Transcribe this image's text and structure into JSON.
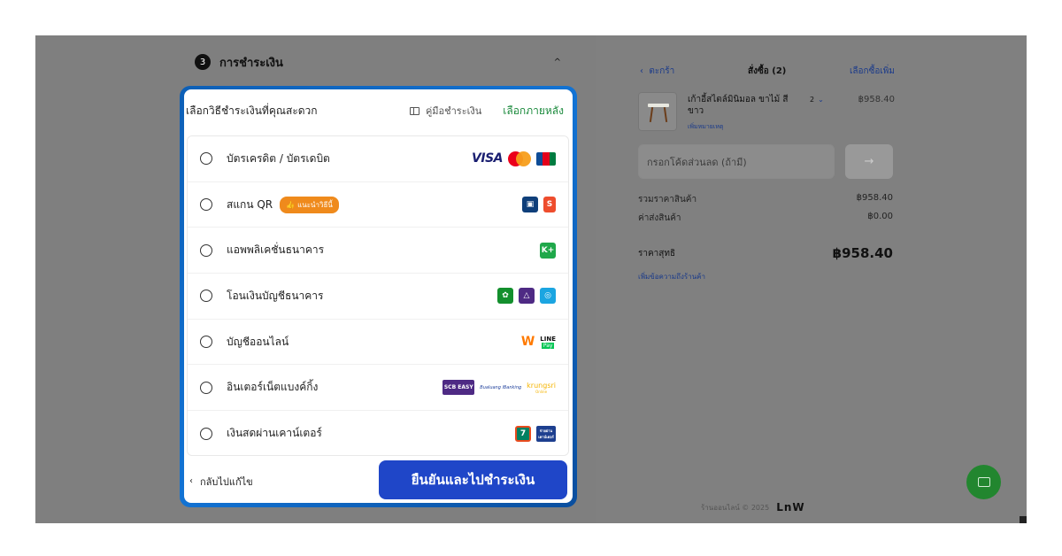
{
  "step": {
    "number": "3",
    "title": "การชำระเงิน",
    "chevron": "^"
  },
  "modal": {
    "title": "เลือกวิธีชำระเงินที่คุณสะดวก",
    "guide_label": "คู่มือชำระเงิน",
    "later_label": "เลือกภายหลัง",
    "options": [
      {
        "label": "บัตรเครดิต / บัตรเดบิต",
        "logos": [
          "visa",
          "mastercard",
          "jcb"
        ]
      },
      {
        "label": "สแกน QR",
        "badge": "แนะนำวิธีนี้",
        "logos": [
          "qr-scan",
          "shopee-s"
        ]
      },
      {
        "label": "แอพพลิเคชั่นธนาคาร",
        "logos": [
          "kplus"
        ]
      },
      {
        "label": "โอนเงินบัญชีธนาคาร",
        "logos": [
          "kbank",
          "scb",
          "krungthai"
        ]
      },
      {
        "label": "บัญชีออนไลน์",
        "logos": [
          "truemoney",
          "linepay"
        ]
      },
      {
        "label": "อินเตอร์เน็ตแบงค์กิ้ง",
        "logos": [
          "scb-easy",
          "bualuang",
          "krungsri"
        ]
      },
      {
        "label": "เงินสดผ่านเคาน์เตอร์",
        "logos": [
          "7-eleven",
          "counter-service"
        ]
      }
    ],
    "back_label": "กลับไปแก้ไข",
    "confirm_label": "ยืนยันและไปชำระเงิน",
    "logo_text": {
      "visa": "VISA",
      "mastercard_caption": "mastercard",
      "line": "LINE",
      "pay": "Pay",
      "scb_easy_1": "SCB",
      "scb_easy_2": "EASY",
      "bualuang": "Bualuang iBanking",
      "krungsri": "krungsri",
      "krungsri_sub": "Online",
      "kplus": "K+",
      "shopee": "S",
      "mpay_1": "จ่ายผ่าน",
      "mpay_2": "เคาน์เตอร์"
    }
  },
  "cart": {
    "back_label": "ตะกร้า",
    "title": "สั่งซื้อ (2)",
    "more_label": "เลือกซื้อเพิ่ม",
    "product": {
      "name": "เก้าอี้สไตล์มินิมอล ขาไม้ สีขาว",
      "note": "เพิ่มหมายเหตุ",
      "qty": "2",
      "qty_chevron": "⌄",
      "price": "฿958.40"
    },
    "coupon_placeholder": "กรอกโค้ดส่วนลด (ถ้ามี)",
    "coupon_arrow": "→",
    "subtotal_label": "รวมราคาสินค้า",
    "subtotal_value": "฿958.40",
    "shipping_label": "ค่าส่งสินค้า",
    "shipping_value": "฿0.00",
    "total_label": "ราคาสุทธิ",
    "total_value": "฿958.40",
    "note_link": "เพิ่มข้อความถึงร้านค้า"
  },
  "footer": {
    "text": "ร้านออนไลน์ © 2025",
    "brand": "LnW"
  },
  "colors": {
    "accent_blue": "#1f46c8",
    "green_link": "#1d8b3e",
    "badge_orange": "#ef8a1c",
    "chat_green": "#22862f"
  }
}
